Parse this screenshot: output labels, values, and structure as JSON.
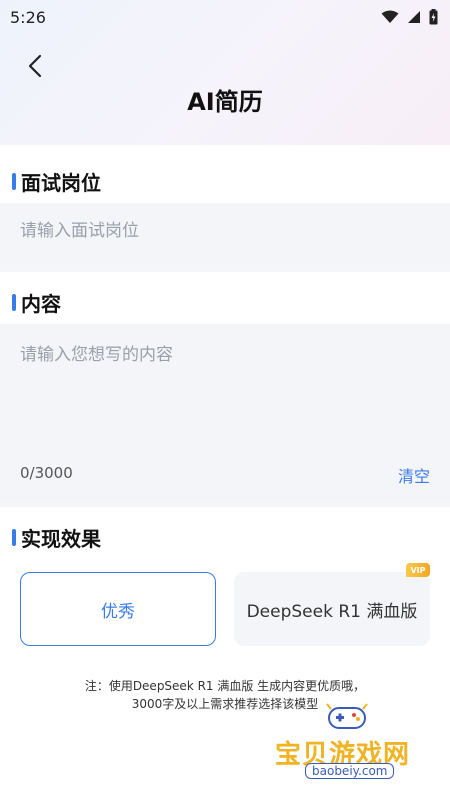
{
  "status_bar": {
    "time": "5:26"
  },
  "header": {
    "title": "AI简历"
  },
  "position_section": {
    "title": "面试岗位",
    "input_placeholder": "请输入面试岗位",
    "input_value": ""
  },
  "content_section": {
    "title": "内容",
    "textarea_placeholder": "请输入您想写的内容",
    "textarea_value": "",
    "counter": "0/3000",
    "clear_label": "清空"
  },
  "effect_section": {
    "title": "实现效果",
    "options": [
      {
        "label": "优秀",
        "selected": true
      },
      {
        "label": "DeepSeek R1 满血版",
        "selected": false,
        "badge": "VIP"
      }
    ]
  },
  "note": {
    "line1": "注：使用DeepSeek R1 满血版 生成内容更优质哦，",
    "line2": "3000字及以上需求推荐选择该模型"
  },
  "watermark": {
    "text": "宝贝游戏网",
    "url": "baobeiy.com"
  },
  "colors": {
    "accent": "#3a7bea",
    "badge": "#f3a623"
  }
}
